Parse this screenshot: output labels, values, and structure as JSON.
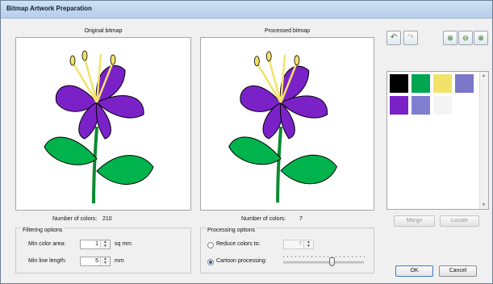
{
  "window": {
    "title": "Bitmap Artwork Preparation"
  },
  "original": {
    "label": "Original bitmap",
    "colors_label": "Number of colors:",
    "colors_value": "210"
  },
  "processed": {
    "label": "Processed bitmap",
    "colors_label": "Number of colors:",
    "colors_value": "7"
  },
  "filtering": {
    "title": "Filtering options",
    "min_color_area": {
      "label": "Min color area:",
      "value": "1",
      "unit": "sq mm"
    },
    "min_line_length": {
      "label": "Min line length:",
      "value": "5",
      "unit": "mm"
    }
  },
  "processing": {
    "title": "Processing options",
    "reduce_colors": {
      "label": "Reduce colors to:",
      "value": "7",
      "selected": false
    },
    "cartoon": {
      "label": "Cartoon processing:",
      "selected": true,
      "level": 0.6
    }
  },
  "toolbar": {
    "icons": [
      "undo-icon",
      "redo-icon",
      "zoom-in-icon",
      "zoom-out-icon",
      "zoom-fit-icon"
    ]
  },
  "palette": {
    "colors": [
      "#000000",
      "#00a650",
      "#f3e26a",
      "#7a76c8",
      "#7a22c8",
      "#7f7fd1",
      "#f4f4f4"
    ]
  },
  "buttons": {
    "merge": "Merge",
    "locate": "Locate",
    "ok": "OK",
    "cancel": "Cancel"
  }
}
